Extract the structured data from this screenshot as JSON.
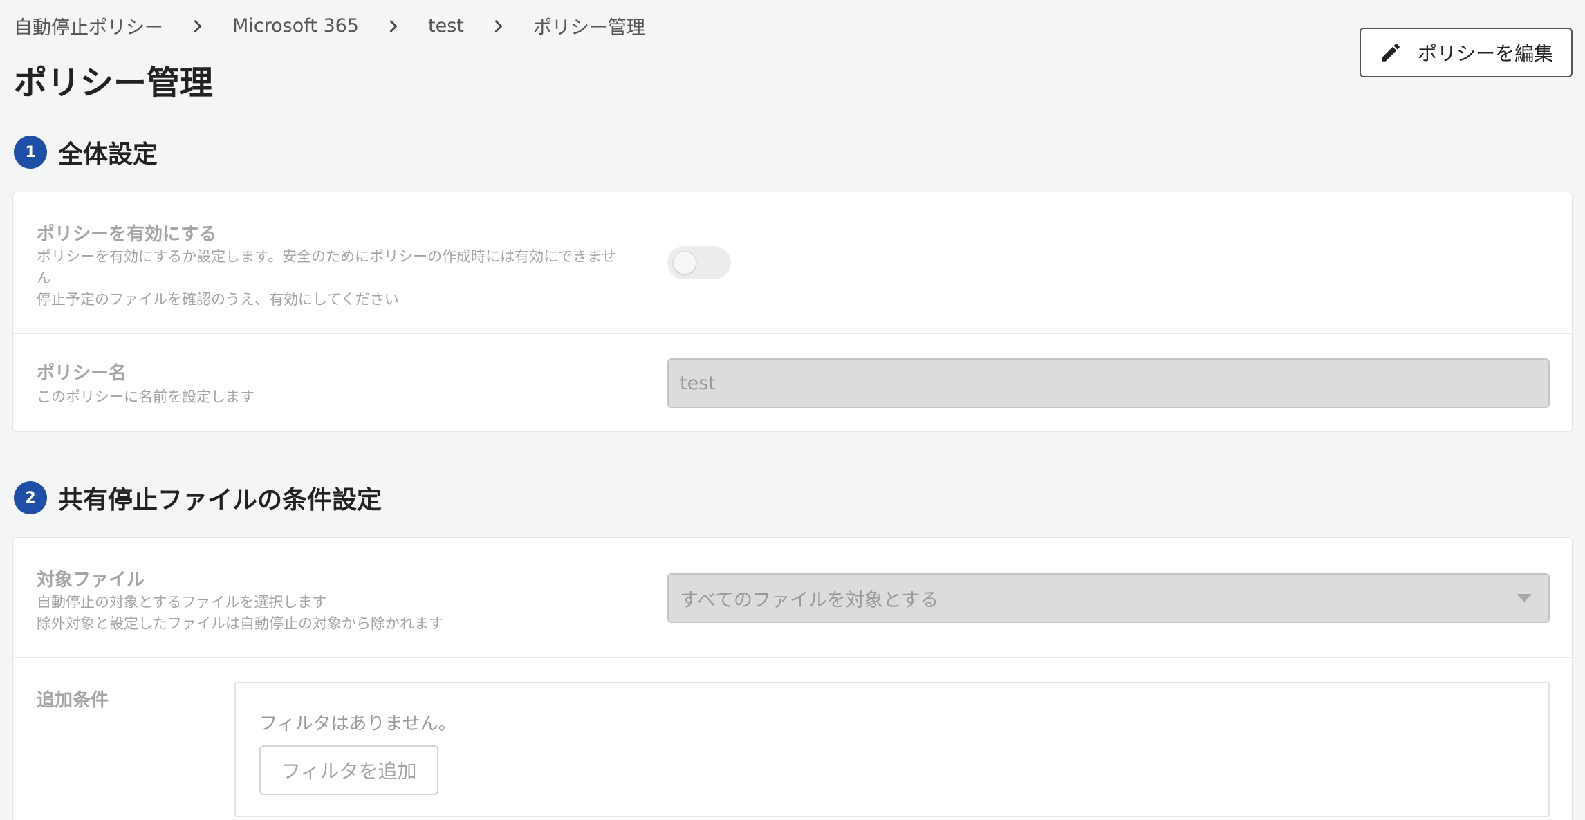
{
  "breadcrumb": [
    {
      "label": "自動停止ポリシー"
    },
    {
      "label": "Microsoft 365"
    },
    {
      "label": "test"
    },
    {
      "label": "ポリシー管理"
    }
  ],
  "page_title": "ポリシー管理",
  "edit_button": {
    "label": "ポリシーを編集",
    "icon": "pencil-icon"
  },
  "sections": {
    "general": {
      "step": "1",
      "title": "全体設定",
      "enable_policy": {
        "label": "ポリシーを有効にする",
        "desc_line1": "ポリシーを有効にするか設定します。安全のためにポリシーの作成時には有効にできませ",
        "desc_line2": "ん",
        "desc_line3": "停止予定のファイルを確認のうえ、有効にしてください",
        "toggle_on": false
      },
      "policy_name": {
        "label": "ポリシー名",
        "desc": "このポリシーに名前を設定します",
        "value": "test"
      }
    },
    "conditions": {
      "step": "2",
      "title": "共有停止ファイルの条件設定",
      "target_files": {
        "label": "対象ファイル",
        "desc_line1": "自動停止の対象とするファイルを選択します",
        "desc_line2": "除外対象と設定したファイルは自動停止の対象から除かれます",
        "selected": "すべてのファイルを対象とする"
      },
      "additional": {
        "label": "追加条件",
        "empty_text": "フィルタはありません。",
        "add_button": "フィルタを追加"
      }
    }
  }
}
